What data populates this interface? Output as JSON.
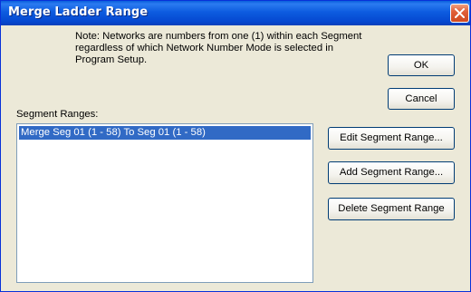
{
  "window": {
    "title": "Merge Ladder Range",
    "close_icon": "close-icon"
  },
  "note": {
    "text": "Note:   Networks are numbers from one (1) within each Segment regardless of which Network Number Mode is selected in Program Setup."
  },
  "buttons": {
    "ok": "OK",
    "cancel": "Cancel",
    "edit": "Edit Segment Range...",
    "add": "Add Segment Range...",
    "delete": "Delete Segment Range"
  },
  "segment_ranges": {
    "label": "Segment Ranges:",
    "items": [
      {
        "text": "Merge Seg 01 (1 - 58) To Seg 01 (1 - 58)",
        "selected": true
      }
    ]
  },
  "colors": {
    "titlebar": "#0A5FDC",
    "selection": "#316AC5",
    "dialog_bg": "#ECE9D8",
    "close_button": "#E0603A"
  }
}
